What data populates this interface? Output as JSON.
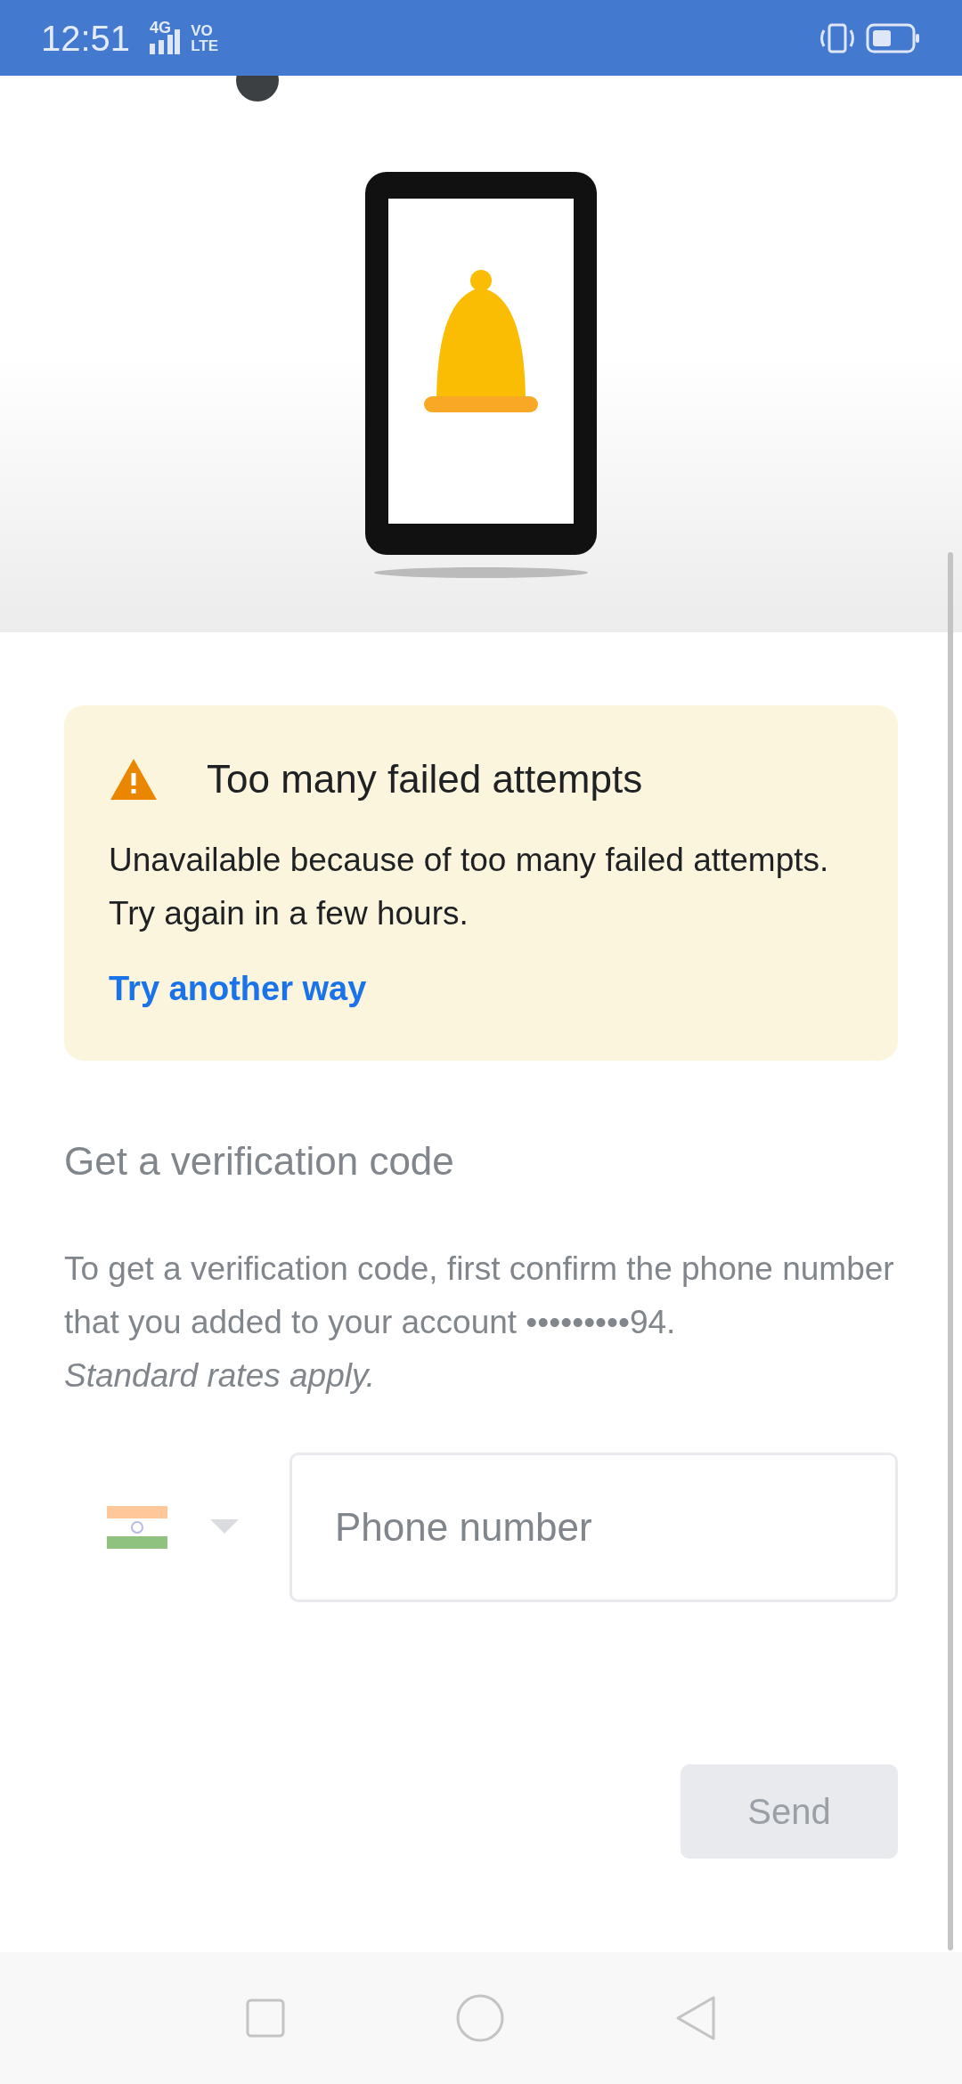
{
  "status_bar": {
    "time": "12:51",
    "network": "4G",
    "volte_top": "VO",
    "volte_bottom": "LTE"
  },
  "alert": {
    "title": "Too many failed attempts",
    "body": "Unavailable because of too many failed attempts. Try again in a few hours.",
    "link": "Try another way"
  },
  "section": {
    "title": "Get a verification code",
    "body": "To get a verification code, first confirm the phone number that you added to your account •••••••••94.",
    "note": "Standard rates apply."
  },
  "phone": {
    "placeholder": "Phone number"
  },
  "send_button": {
    "label": "Send",
    "disabled": true
  }
}
